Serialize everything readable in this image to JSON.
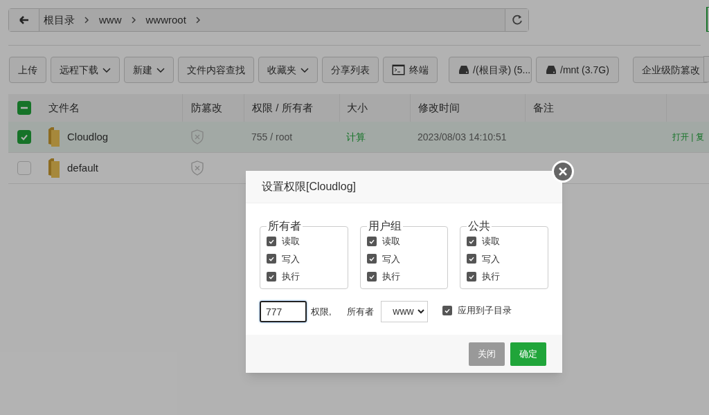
{
  "breadcrumb": {
    "items": [
      "根目录",
      "www",
      "wwwroot"
    ]
  },
  "toolbar": [
    {
      "label": "上传",
      "kind": "plain"
    },
    {
      "label": "远程下载",
      "kind": "dropdown"
    },
    {
      "label": "新建",
      "kind": "dropdown"
    },
    {
      "label": "文件内容查找",
      "kind": "plain"
    },
    {
      "label": "收藏夹",
      "kind": "dropdown"
    },
    {
      "label": "分享列表",
      "kind": "plain"
    },
    {
      "label": "终端",
      "kind": "terminal"
    },
    {
      "label": "/(根目录) (5...",
      "kind": "disk"
    },
    {
      "label": "/mnt (3.7G)",
      "kind": "disk"
    },
    {
      "label": "企业级防篡改",
      "kind": "plain"
    }
  ],
  "table": {
    "header_indeterminate": true,
    "columns": [
      "文件名",
      "防篡改",
      "权限 / 所有者",
      "大小",
      "修改时间",
      "备注"
    ],
    "rows": [
      {
        "checked": true,
        "name": "Cloudlog",
        "perm": "755 / root",
        "size": "计算",
        "modified": "2023/08/03 14:10:51",
        "actions": "打开 | 复"
      },
      {
        "checked": false,
        "name": "default"
      }
    ]
  },
  "dialog": {
    "title": "设置权限[Cloudlog]",
    "groups": [
      {
        "legend": "所有者",
        "options": [
          {
            "label": "读取",
            "checked": true
          },
          {
            "label": "写入",
            "checked": true
          },
          {
            "label": "执行",
            "checked": true
          }
        ]
      },
      {
        "legend": "用户组",
        "options": [
          {
            "label": "读取",
            "checked": true
          },
          {
            "label": "写入",
            "checked": true
          },
          {
            "label": "执行",
            "checked": true
          }
        ]
      },
      {
        "legend": "公共",
        "options": [
          {
            "label": "读取",
            "checked": true
          },
          {
            "label": "写入",
            "checked": true
          },
          {
            "label": "执行",
            "checked": true
          }
        ]
      }
    ],
    "mode_value": "777",
    "mode_label": "权限,",
    "owner_label": "所有者",
    "owner_value": "www",
    "recursive": {
      "label": "应用到子目录",
      "checked": true
    },
    "buttons": [
      {
        "label": "关闭",
        "disabled": true
      },
      {
        "label": "确定",
        "disabled": false
      }
    ]
  }
}
